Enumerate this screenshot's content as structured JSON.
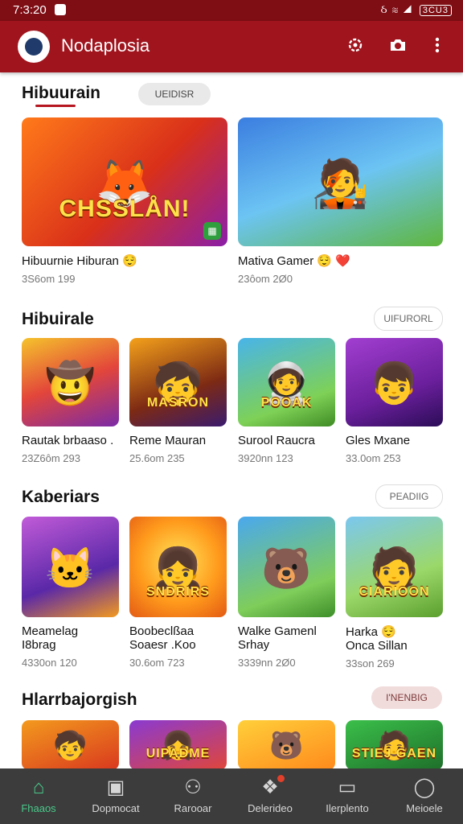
{
  "status": {
    "time": "7:3:20",
    "right": "ઠ ≋ ◢",
    "battery": "3CU3"
  },
  "appbar": {
    "title": "Nodaplosia",
    "logo": "logo-avatar",
    "actions": [
      "settings-icon",
      "camera-icon",
      "more-icon"
    ]
  },
  "sections": [
    {
      "title": "Hibuurain",
      "pill": "UEIDISR",
      "cards": [
        {
          "title": "Hibuurnie Hiburan 😌",
          "meta": "3S6om 199",
          "caption": "CHSSLÅN!",
          "art": "🦊",
          "bg": "linear-gradient(135deg,#ff7a1a,#d9301a 55%,#8b1fa8)"
        },
        {
          "title": "Mativa Gamer 😌 ❤️",
          "meta": "23ôom 2Ø0",
          "caption": "",
          "art": "🧑‍🎤",
          "bg": "linear-gradient(160deg,#3b7ee0,#6cc4f3 50%,#5fb63c)"
        }
      ]
    },
    {
      "title": "Hibuirale",
      "pill": "UIFURORL",
      "cards": [
        {
          "title": "Rautak brbaaso .",
          "sub": "",
          "meta": "23Z6ôm 293",
          "caption": "",
          "art": "🤠",
          "bg": "linear-gradient(160deg,#f5c32c,#e3463a 50%,#7a2aa8)"
        },
        {
          "title": "Reme Mauran",
          "sub": "",
          "meta": "25.6om 235",
          "caption": "MASRON",
          "art": "🧒",
          "bg": "linear-gradient(160deg,#f4a11b,#7d2a14 60%,#3a1b6e)"
        },
        {
          "title": "Surool Raucra",
          "sub": "",
          "meta": "3920nn 123",
          "caption": "POOAK",
          "art": "🧑‍🚀",
          "bg": "linear-gradient(160deg,#48b4ea,#7ed156 70%,#3f8b25)"
        },
        {
          "title": "Gles Mxane",
          "sub": "",
          "meta": "33.0om 253",
          "caption": "",
          "art": "👦",
          "bg": "linear-gradient(160deg,#a23fd1,#6b1f9c 60%,#2b0d57)"
        }
      ]
    },
    {
      "title": "Kaberiars",
      "pill": "PEADIIG",
      "cards": [
        {
          "title": "Meamelag",
          "sub": "I8brag",
          "meta": "4330on 120",
          "caption": "",
          "art": "🐱",
          "bg": "linear-gradient(160deg,#c15bd8,#5a28a8 60%,#f39a1e)"
        },
        {
          "title": "Boobeclßaa",
          "sub": "Soaesr .Koo",
          "meta": "30.6om 723",
          "caption": "SNDRIRS",
          "art": "👧",
          "bg": "radial-gradient(circle at 50% 45%,#ffe65a,#ff9a1c 55%,#e35a14)"
        },
        {
          "title": "Walke Gamenl",
          "sub": "Srhay",
          "meta": "3339nn 2Ø0",
          "caption": "",
          "art": "🐻",
          "bg": "linear-gradient(160deg,#4aa8ee,#7fcd5a 70%,#3e8e2a)"
        },
        {
          "title": "Harka 😌",
          "sub": "Onca Sillan",
          "meta": "33son 269",
          "caption": "CIARIOON",
          "art": "🧑",
          "bg": "linear-gradient(160deg,#7bc7f0,#9bd86a 60%,#5b9f2e)"
        }
      ]
    },
    {
      "title": "Hlarrbajorgish",
      "pill": "I'NENBIG",
      "cards": [
        {
          "title": "",
          "meta": "",
          "caption": "",
          "art": "🧒",
          "bg": "linear-gradient(160deg,#f39a1e,#d9381e)"
        },
        {
          "title": "",
          "meta": "",
          "caption": "UIPADME",
          "art": "👧",
          "bg": "linear-gradient(160deg,#8a3ad1,#e0463a)"
        },
        {
          "title": "",
          "meta": "",
          "caption": "",
          "art": "🐻",
          "bg": "linear-gradient(160deg,#ffcf3a,#ff8a1c)"
        },
        {
          "title": "",
          "meta": "",
          "caption": "STIEJ GAEN",
          "art": "🧑",
          "bg": "linear-gradient(160deg,#3bbf4a,#1e6f2a)"
        }
      ]
    }
  ],
  "nav": [
    {
      "label": "Fhaaos",
      "icon": "home-icon",
      "glyph": "⌂",
      "active": true
    },
    {
      "label": "Dopmocat",
      "icon": "gamepad-icon",
      "glyph": "▣",
      "active": false
    },
    {
      "label": "Rarooar",
      "icon": "person-icon",
      "glyph": "⚇",
      "active": false
    },
    {
      "label": "Delerideo",
      "icon": "apps-icon",
      "glyph": "❖",
      "active": false
    },
    {
      "label": "Ilerplento",
      "icon": "folder-icon",
      "glyph": "▭",
      "active": false
    },
    {
      "label": "Meioele",
      "icon": "profile-icon",
      "glyph": "◯",
      "active": false
    }
  ],
  "colors": {
    "appbar": "#a0141d",
    "statusbar": "#7e0d14",
    "navbar": "#3c3c3c",
    "active": "#49c98a"
  }
}
